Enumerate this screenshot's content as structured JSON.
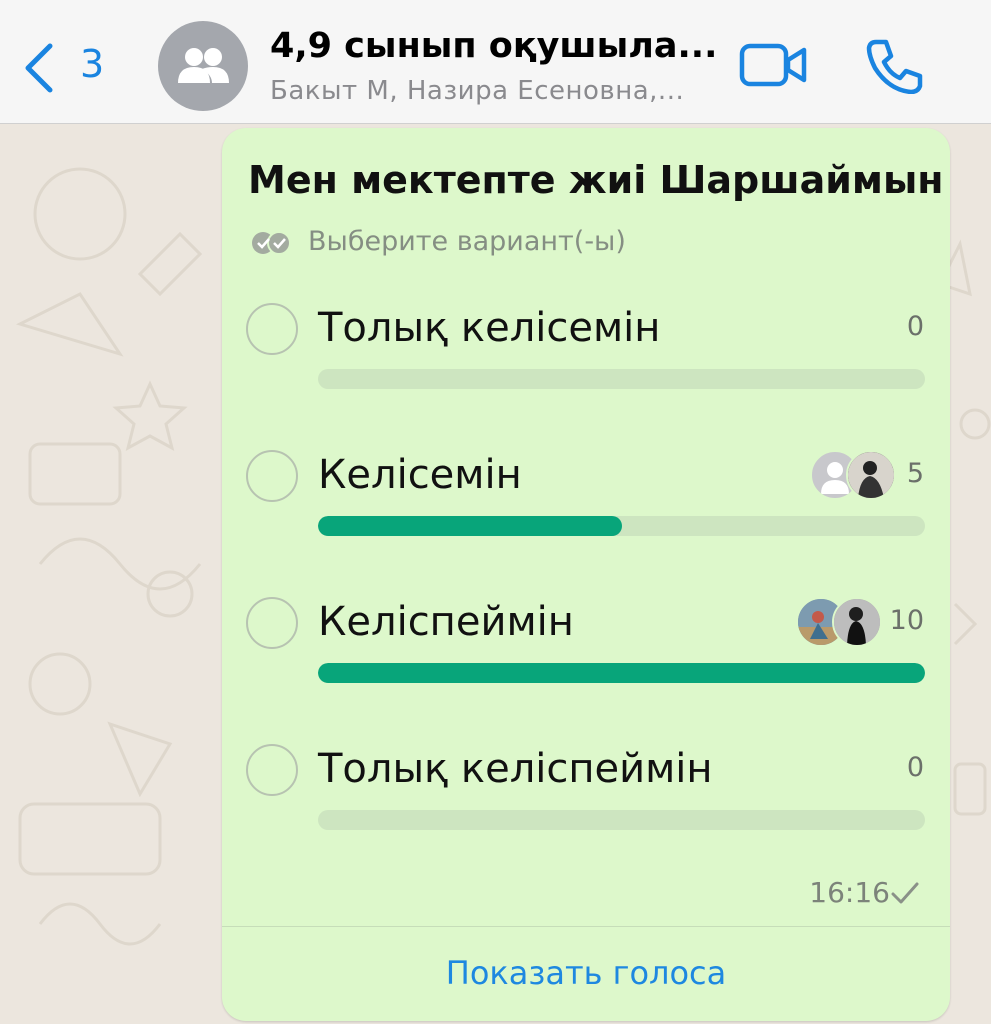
{
  "header": {
    "back_count": "3",
    "title": "4,9 сынып оқушыла...",
    "subtitle": "Бакыт М, Назира Есеновна,...",
    "icons": {
      "back": "chevron-left-icon",
      "avatar": "group-icon",
      "video": "video-call-icon",
      "call": "phone-icon"
    }
  },
  "poll": {
    "question": "Мен мектепте жиі Шаршаймын",
    "hint": "Выберите вариант(-ы)",
    "options": [
      {
        "label": "Толық келісемін",
        "count": "0",
        "fill": 0
      },
      {
        "label": "Келісемін",
        "count": "5",
        "fill": 0.5
      },
      {
        "label": "Келіспеймін",
        "count": "10",
        "fill": 1
      },
      {
        "label": "Толық келіспеймін",
        "count": "0",
        "fill": 0
      }
    ],
    "time": "16:16",
    "show_votes": "Показать голоса"
  },
  "colors": {
    "accent": "#1A84E0",
    "bubble": "#DDF8CB",
    "bar_fill": "#08A57A",
    "bar_track": "#CDE5C0"
  }
}
